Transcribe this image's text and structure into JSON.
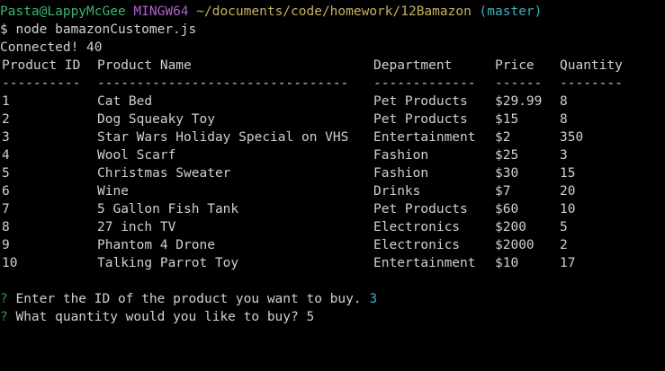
{
  "prompt": {
    "user_host": "Pasta@LappyMcGee",
    "system": "MINGW64",
    "path": "~/documents/code/homework/12Bamazon",
    "branch": "(master)"
  },
  "command": "$ node bamazonCustomer.js",
  "connected": "Connected! 40",
  "table": {
    "headers": {
      "id": "Product ID",
      "name": "Product Name",
      "department": "Department",
      "price": "Price",
      "quantity": "Quantity"
    },
    "separators": {
      "id": "----------",
      "name": "--------------------------------",
      "department": "-------------",
      "price": "------",
      "quantity": "--------"
    },
    "rows": [
      {
        "id": "1",
        "name": "Cat Bed",
        "department": "Pet Products",
        "price": "$29.99",
        "quantity": "8"
      },
      {
        "id": "2",
        "name": "Dog Squeaky Toy",
        "department": "Pet Products",
        "price": "$15",
        "quantity": "8"
      },
      {
        "id": "3",
        "name": "Star Wars Holiday Special on VHS",
        "department": "Entertainment",
        "price": "$2",
        "quantity": "350"
      },
      {
        "id": "4",
        "name": "Wool Scarf",
        "department": "Fashion",
        "price": "$25",
        "quantity": "3"
      },
      {
        "id": "5",
        "name": "Christmas Sweater",
        "department": "Fashion",
        "price": "$30",
        "quantity": "15"
      },
      {
        "id": "6",
        "name": "Wine",
        "department": "Drinks",
        "price": "$7",
        "quantity": "20"
      },
      {
        "id": "7",
        "name": "5 Gallon Fish Tank",
        "department": "Pet Products",
        "price": "$60",
        "quantity": "10"
      },
      {
        "id": "8",
        "name": "27 inch TV",
        "department": "Electronics",
        "price": "$200",
        "quantity": "5"
      },
      {
        "id": "9",
        "name": "Phantom 4 Drone",
        "department": "Electronics",
        "price": "$2000",
        "quantity": "2"
      },
      {
        "id": "10",
        "name": "Talking Parrot Toy",
        "department": "Entertainment",
        "price": "$10",
        "quantity": "17"
      }
    ]
  },
  "questions": [
    {
      "mark": "?",
      "text": "Enter the ID of the product you want to buy.",
      "answer": "3"
    },
    {
      "mark": "?",
      "text": "What quantity would you like to buy?",
      "answer": "5"
    }
  ],
  "colors": {
    "background": "#000000",
    "text": "#c0c0c0",
    "user_host": "#3cb371",
    "system": "#b060c8",
    "path": "#c8b060",
    "branch": "#3fb0c0",
    "question_mark": "#2ea043",
    "answer": "#3fb0c0"
  }
}
